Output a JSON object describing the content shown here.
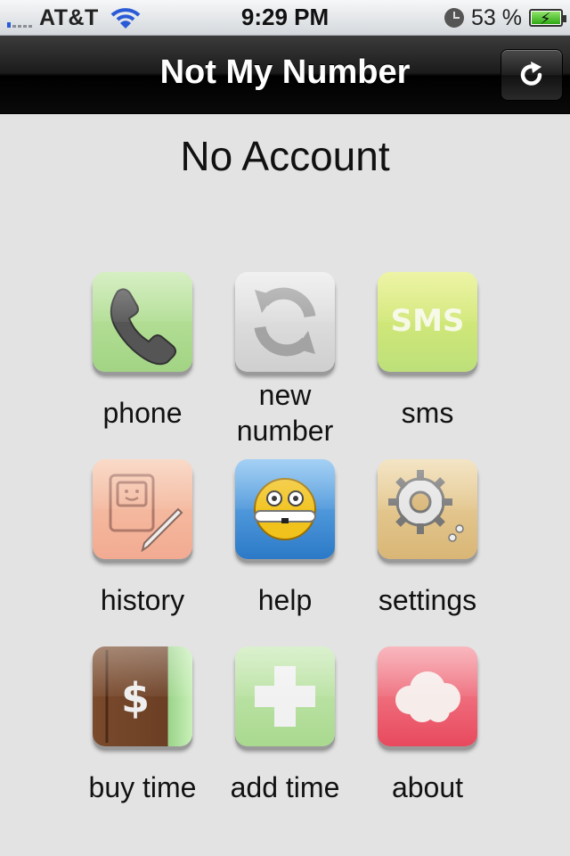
{
  "status_bar": {
    "carrier": "AT&T",
    "time": "9:29 PM",
    "battery_percent": "53 %",
    "battery_level": 0.53,
    "icons": [
      "signal-icon",
      "wifi-icon",
      "clock-icon",
      "battery-icon"
    ]
  },
  "nav": {
    "title": "Not My Number",
    "refresh_icon": "refresh-icon"
  },
  "account_status": "No Account",
  "tiles": [
    {
      "label": "phone",
      "icon": "phone-icon",
      "color": "#a9d98a"
    },
    {
      "label": "new\nnumber",
      "icon": "refresh-arrows-icon",
      "color": "#d6d6d6"
    },
    {
      "label": "sms",
      "icon": "sms-icon",
      "color": "#c9e478"
    },
    {
      "label": "history",
      "icon": "history-icon",
      "color": "#f2b69a"
    },
    {
      "label": "help",
      "icon": "smiley-icon",
      "color": "#3f8fd6"
    },
    {
      "label": "settings",
      "icon": "gear-icon",
      "color": "#e1c486"
    },
    {
      "label": "buy time",
      "icon": "dollar-book-icon",
      "color": "#7a4a2c"
    },
    {
      "label": "add time",
      "icon": "plus-icon",
      "color": "#b5e09e"
    },
    {
      "label": "about",
      "icon": "cloud-icon",
      "color": "#ee5a6b"
    }
  ]
}
